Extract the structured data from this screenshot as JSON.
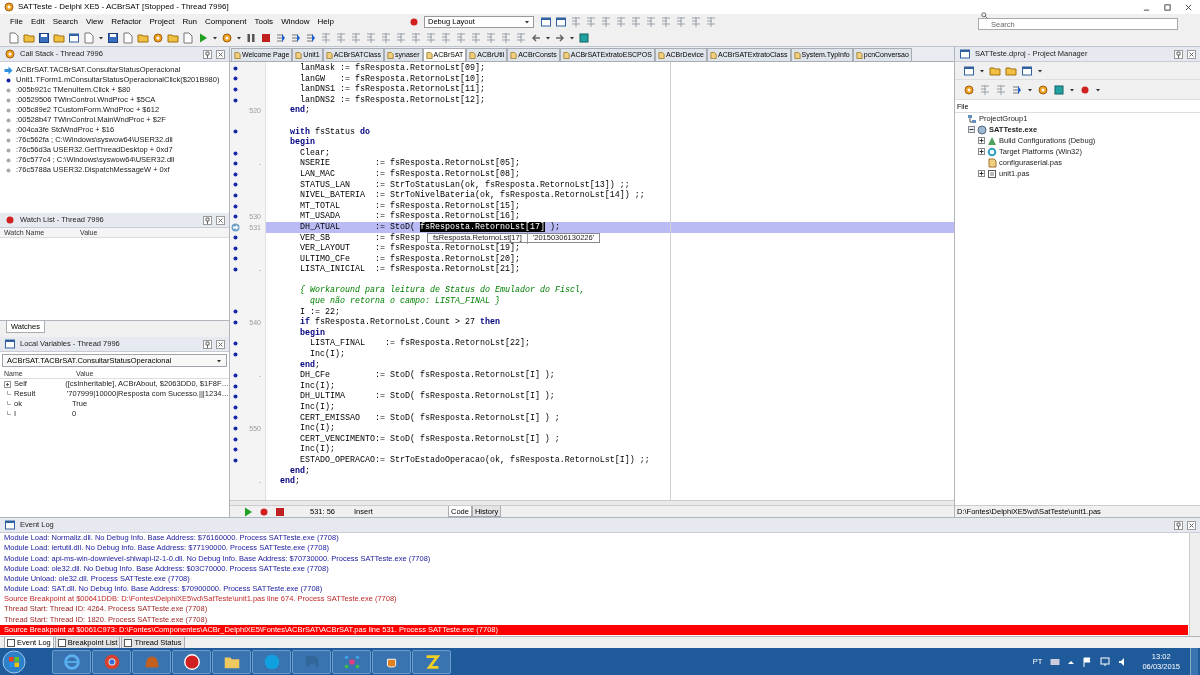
{
  "window": {
    "title": "SATTeste - Delphi XE5 - ACBrSAT [Stopped - Thread 7996]"
  },
  "menu": [
    "File",
    "Edit",
    "Search",
    "View",
    "Refactor",
    "Project",
    "Run",
    "Component",
    "Tools",
    "Window",
    "Help"
  ],
  "layout_dropdown": {
    "value": "Debug Layout"
  },
  "search": {
    "placeholder": "Search"
  },
  "call_stack": {
    "title": "Call Stack - Thread 7996",
    "frames": [
      {
        "kind": "current",
        "text": "ACBrSAT.TACBrSAT.ConsultarStatusOperacional"
      },
      {
        "kind": "source",
        "text": "Unit1.TForm1.mConsultarStatusOperacionalClick($201B980)"
      },
      {
        "kind": "address",
        "text": ":005b921c TMenuItem.Click + $80"
      },
      {
        "kind": "address",
        "text": ":00529506 TWinControl.WndProc + $5CA"
      },
      {
        "kind": "address",
        "text": ":005c89e2 TCustomForm.WndProc + $612"
      },
      {
        "kind": "address",
        "text": ":00528b47 TWinControl.MainWndProc + $2F"
      },
      {
        "kind": "address",
        "text": ":004ca3fe StdWndProc + $16"
      },
      {
        "kind": "address",
        "text": ":76c562fa ; C:\\Windows\\syswow64\\USER32.dll"
      },
      {
        "kind": "address",
        "text": ":76c56d3a USER32.GetThreadDesktop + 0xd7"
      },
      {
        "kind": "address",
        "text": ":76c577c4 ; C:\\Windows\\syswow64\\USER32.dll"
      },
      {
        "kind": "address",
        "text": ":76c5788a USER32.DispatchMessageW + 0xf"
      }
    ]
  },
  "watch_list": {
    "title": "Watch List - Thread 7996",
    "columns": [
      "Watch Name",
      "Value"
    ],
    "tabs": [
      {
        "label": "Watches",
        "selected": true
      }
    ]
  },
  "local_variables": {
    "title": "Local Variables - Thread 7996",
    "scope": "ACBrSAT.TACBrSAT.ConsultarStatusOperacional",
    "columns": [
      "Name",
      "Value"
    ],
    "rows": [
      {
        "kind": "object",
        "name": "Self",
        "value": "([csInheritable], ACBrAbout, $2063DD0, $1F8F…"
      },
      {
        "kind": "simple",
        "name": "Result",
        "value": "'707999|10000|Resposta com Sucesso.|||1234…"
      },
      {
        "kind": "simple",
        "name": "ok",
        "value": "True"
      },
      {
        "kind": "simple",
        "name": "I",
        "value": "0"
      }
    ]
  },
  "editor": {
    "tabs": [
      {
        "label": "Welcome Page",
        "selected": false
      },
      {
        "label": "Unit1",
        "selected": false
      },
      {
        "label": "ACBrSATClass",
        "selected": false
      },
      {
        "label": "synaser",
        "selected": false
      },
      {
        "label": "ACBrSAT",
        "selected": true
      },
      {
        "label": "ACBrUtil",
        "selected": false
      },
      {
        "label": "ACBrConsts",
        "selected": false
      },
      {
        "label": "ACBrSATExtratoESCPOS",
        "selected": false
      },
      {
        "label": "ACBrDevice",
        "selected": false
      },
      {
        "label": "ACBrSATExtratoClass",
        "selected": false
      },
      {
        "label": "System.TypInfo",
        "selected": false
      },
      {
        "label": "pcnConversao",
        "selected": false
      }
    ],
    "lines": [
      {
        "kind": "breakable",
        "code": "      lanMask := fsResposta.RetornoLst[09];"
      },
      {
        "kind": "breakable",
        "code": "      lanGW   := fsResposta.RetornoLst[10];"
      },
      {
        "kind": "breakable",
        "code": "      lanDNS1 := fsResposta.RetornoLst[11];"
      },
      {
        "kind": "breakable",
        "code": "      lanDNS2 := fsResposta.RetornoLst[12];"
      },
      {
        "kind": "plain",
        "number": "520",
        "code": "    **end**;"
      },
      {
        "kind": "plain"
      },
      {
        "kind": "breakable",
        "code": "    **with** fsStatus **do**"
      },
      {
        "kind": "plain",
        "code": "    **begin**"
      },
      {
        "kind": "breakable",
        "code": "      Clear;"
      },
      {
        "kind": "breakable",
        "number": "-",
        "code": "      NSERIE         := fsResposta.RetornoLst[05];"
      },
      {
        "kind": "breakable",
        "code": "      LAN_MAC        := fsResposta.RetornoLst[08];"
      },
      {
        "kind": "breakable",
        "code": "      STATUS_LAN     := StrToStatusLan(ok, fsResposta.RetornoLst[13]) ;;"
      },
      {
        "kind": "breakable",
        "code": "      NIVEL_BATERIA  := StrToNivelBateria(ok, fsResposta.RetornoLst[14]) ;;"
      },
      {
        "kind": "breakable",
        "code": "      MT_TOTAL       := fsResposta.RetornoLst[15];"
      },
      {
        "kind": "breakable",
        "number": "530",
        "code": "      MT_USADA       := fsResposta.RetornoLst[16];"
      },
      {
        "kind": "current",
        "number": "531",
        "code": "      DH_ATUAL       := StoD( ",
        "selection": "fsResposta.RetornoLst[17]",
        "code_after": " );"
      },
      {
        "kind": "breakable",
        "code": "      VER_SB         := fsResp"
      },
      {
        "kind": "breakable",
        "code": "      VER_LAYOUT     := fsResposta.RetornoLst[19];"
      },
      {
        "kind": "breakable",
        "code": "      ULTIMO_CFe     := fsResposta.RetornoLst[20];"
      },
      {
        "kind": "breakable",
        "number": "-",
        "code": "      LISTA_INICIAL  := fsResposta.RetornoLst[21];"
      },
      {
        "kind": "plain"
      },
      {
        "kind": "plain",
        "code": "      *{ Workaround para leitura de Status do Emulador do Fiscl,*"
      },
      {
        "kind": "plain",
        "code": "        *que não retorna o campo: LISTA_FINAL }*"
      },
      {
        "kind": "breakable",
        "code": "      I := 22;"
      },
      {
        "kind": "breakable",
        "number": "540",
        "code": "      **if** fsResposta.RetornoLst.Count > 27 **then**"
      },
      {
        "kind": "plain",
        "code": "      **begin**"
      },
      {
        "kind": "breakable",
        "code": "        LISTA_FINAL    := fsResposta.RetornoLst[22];"
      },
      {
        "kind": "breakable",
        "code": "        Inc(I);"
      },
      {
        "kind": "plain",
        "code": "      **end**;"
      },
      {
        "kind": "breakable",
        "number": "-",
        "code": "      DH_CFe         := StoD( fsResposta.RetornoLst[I] );"
      },
      {
        "kind": "breakable",
        "code": "      Inc(I);"
      },
      {
        "kind": "breakable",
        "code": "      DH_ULTIMA      := StoD( fsResposta.RetornoLst[I] );"
      },
      {
        "kind": "breakable",
        "code": "      Inc(I);"
      },
      {
        "kind": "breakable",
        "code": "      CERT_EMISSAO   := StoD( fsResposta.RetornoLst[I] ) ;"
      },
      {
        "kind": "breakable",
        "number": "550",
        "code": "      Inc(I);"
      },
      {
        "kind": "breakable",
        "code": "      CERT_VENCIMENTO:= StoD( fsResposta.RetornoLst[I] ) ;"
      },
      {
        "kind": "breakable",
        "code": "      Inc(I);"
      },
      {
        "kind": "breakable",
        "code": "      ESTADO_OPERACAO:= StrToEstadoOperacao(ok, fsResposta.RetornoLst[I]) ;;"
      },
      {
        "kind": "plain",
        "code": "    **end**;"
      },
      {
        "kind": "plain",
        "number": "-",
        "code": "  **end**;"
      }
    ],
    "tooltip": {
      "expression": "fsResposta.RetornoLst[17]",
      "value": "'20150306130226'"
    },
    "status": {
      "position": "531: 56",
      "mode": "Insert"
    },
    "view_tabs": [
      {
        "label": "Code",
        "selected": true
      },
      {
        "label": "History",
        "selected": false
      }
    ]
  },
  "project_manager": {
    "title": "SATTeste.dproj - Project Manager",
    "column": "File",
    "tree": [
      {
        "label": "ProjectGroup1",
        "kind": "group",
        "children": [
          {
            "label": "SATTeste.exe",
            "kind": "project",
            "expanded": true,
            "children": [
              {
                "label": "Build Configurations (Debug)",
                "kind": "build",
                "expanded": false
              },
              {
                "label": "Target Platforms (Win32)",
                "kind": "platform",
                "expanded": false
              },
              {
                "label": "configuraserial.pas",
                "kind": "unit"
              },
              {
                "label": "unit1.pas",
                "kind": "form",
                "expanded": false
              }
            ]
          }
        ]
      }
    ],
    "path": "D:\\Fontes\\DelphiXE5\\vd\\SatTeste\\unit1.pas"
  },
  "event_log": {
    "title": "Event Log",
    "entries": [
      {
        "kind": "module",
        "selected": false,
        "text": "Module Load: Normaliz.dll. No Debug Info. Base Address: $76160000. Process SATTeste.exe (7708)"
      },
      {
        "kind": "module",
        "selected": false,
        "text": "Module Load: iertutil.dll. No Debug Info. Base Address: $77190000. Process SATTeste.exe (7708)"
      },
      {
        "kind": "module",
        "selected": false,
        "text": "Module Load: api-ms-win-downlevel-shlwapi-l2-1-0.dll. No Debug Info. Base Address: $70730000. Process SATTeste.exe (7708)"
      },
      {
        "kind": "module",
        "selected": false,
        "text": "Module Load: ole32.dll. No Debug Info. Base Address: $03C70000. Process SATTeste.exe (7708)"
      },
      {
        "kind": "module",
        "selected": false,
        "text": "Module Unload: ole32.dll. Process SATTeste.exe (7708)"
      },
      {
        "kind": "module",
        "selected": false,
        "text": "Module Load: SAT.dll. No Debug Info. Base Address: $70900000. Process SATTeste.exe (7708)"
      },
      {
        "kind": "breakpoint",
        "selected": false,
        "text": "Source Breakpoint at $00641DDB: D:\\Fontes\\DelphiXE5\\vd\\SatTeste\\unit1.pas line 674. Process SATTeste.exe (7708)"
      },
      {
        "kind": "thread",
        "selected": false,
        "text": "Thread Start: Thread ID: 4264. Process SATTeste.exe (7708)"
      },
      {
        "kind": "thread",
        "selected": false,
        "text": "Thread Start: Thread ID: 1820. Process SATTeste.exe (7708)"
      },
      {
        "kind": "breakpoint",
        "selected": true,
        "text": "Source Breakpoint at $0061C973: D:\\Fontes\\Componentes\\ACBr_DelphiXE5\\Fontes\\ACBrSAT\\ACBrSAT.pas line 531. Process SATTeste.exe (7708)"
      }
    ],
    "tabs": [
      {
        "label": "Event Log",
        "selected": true
      },
      {
        "label": "Breakpoint List",
        "selected": false
      },
      {
        "label": "Thread Status",
        "selected": false
      }
    ]
  },
  "taskbar": {
    "language": "PT",
    "time": "13:02",
    "date": "06/03/2015"
  }
}
